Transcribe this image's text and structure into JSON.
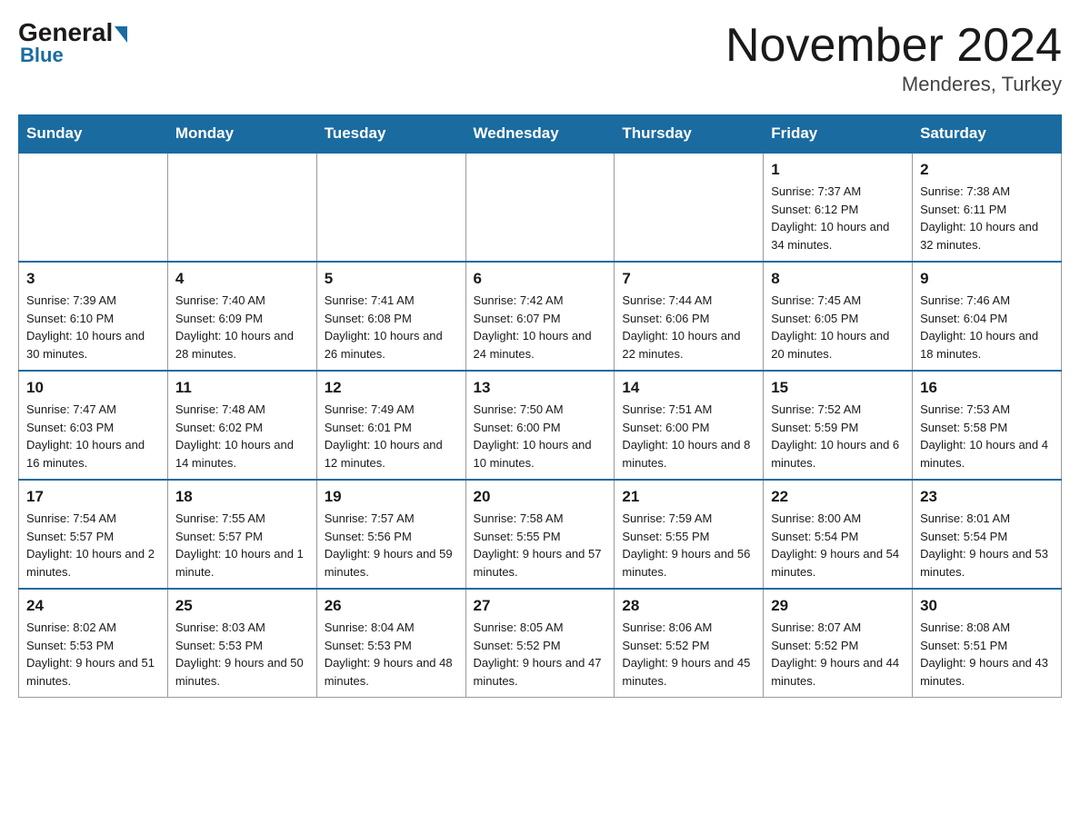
{
  "header": {
    "logo_general": "General",
    "logo_blue": "Blue",
    "month_year": "November 2024",
    "location": "Menderes, Turkey"
  },
  "days_of_week": [
    "Sunday",
    "Monday",
    "Tuesday",
    "Wednesday",
    "Thursday",
    "Friday",
    "Saturday"
  ],
  "weeks": [
    [
      {
        "day": "",
        "info": ""
      },
      {
        "day": "",
        "info": ""
      },
      {
        "day": "",
        "info": ""
      },
      {
        "day": "",
        "info": ""
      },
      {
        "day": "",
        "info": ""
      },
      {
        "day": "1",
        "info": "Sunrise: 7:37 AM\nSunset: 6:12 PM\nDaylight: 10 hours and 34 minutes."
      },
      {
        "day": "2",
        "info": "Sunrise: 7:38 AM\nSunset: 6:11 PM\nDaylight: 10 hours and 32 minutes."
      }
    ],
    [
      {
        "day": "3",
        "info": "Sunrise: 7:39 AM\nSunset: 6:10 PM\nDaylight: 10 hours and 30 minutes."
      },
      {
        "day": "4",
        "info": "Sunrise: 7:40 AM\nSunset: 6:09 PM\nDaylight: 10 hours and 28 minutes."
      },
      {
        "day": "5",
        "info": "Sunrise: 7:41 AM\nSunset: 6:08 PM\nDaylight: 10 hours and 26 minutes."
      },
      {
        "day": "6",
        "info": "Sunrise: 7:42 AM\nSunset: 6:07 PM\nDaylight: 10 hours and 24 minutes."
      },
      {
        "day": "7",
        "info": "Sunrise: 7:44 AM\nSunset: 6:06 PM\nDaylight: 10 hours and 22 minutes."
      },
      {
        "day": "8",
        "info": "Sunrise: 7:45 AM\nSunset: 6:05 PM\nDaylight: 10 hours and 20 minutes."
      },
      {
        "day": "9",
        "info": "Sunrise: 7:46 AM\nSunset: 6:04 PM\nDaylight: 10 hours and 18 minutes."
      }
    ],
    [
      {
        "day": "10",
        "info": "Sunrise: 7:47 AM\nSunset: 6:03 PM\nDaylight: 10 hours and 16 minutes."
      },
      {
        "day": "11",
        "info": "Sunrise: 7:48 AM\nSunset: 6:02 PM\nDaylight: 10 hours and 14 minutes."
      },
      {
        "day": "12",
        "info": "Sunrise: 7:49 AM\nSunset: 6:01 PM\nDaylight: 10 hours and 12 minutes."
      },
      {
        "day": "13",
        "info": "Sunrise: 7:50 AM\nSunset: 6:00 PM\nDaylight: 10 hours and 10 minutes."
      },
      {
        "day": "14",
        "info": "Sunrise: 7:51 AM\nSunset: 6:00 PM\nDaylight: 10 hours and 8 minutes."
      },
      {
        "day": "15",
        "info": "Sunrise: 7:52 AM\nSunset: 5:59 PM\nDaylight: 10 hours and 6 minutes."
      },
      {
        "day": "16",
        "info": "Sunrise: 7:53 AM\nSunset: 5:58 PM\nDaylight: 10 hours and 4 minutes."
      }
    ],
    [
      {
        "day": "17",
        "info": "Sunrise: 7:54 AM\nSunset: 5:57 PM\nDaylight: 10 hours and 2 minutes."
      },
      {
        "day": "18",
        "info": "Sunrise: 7:55 AM\nSunset: 5:57 PM\nDaylight: 10 hours and 1 minute."
      },
      {
        "day": "19",
        "info": "Sunrise: 7:57 AM\nSunset: 5:56 PM\nDaylight: 9 hours and 59 minutes."
      },
      {
        "day": "20",
        "info": "Sunrise: 7:58 AM\nSunset: 5:55 PM\nDaylight: 9 hours and 57 minutes."
      },
      {
        "day": "21",
        "info": "Sunrise: 7:59 AM\nSunset: 5:55 PM\nDaylight: 9 hours and 56 minutes."
      },
      {
        "day": "22",
        "info": "Sunrise: 8:00 AM\nSunset: 5:54 PM\nDaylight: 9 hours and 54 minutes."
      },
      {
        "day": "23",
        "info": "Sunrise: 8:01 AM\nSunset: 5:54 PM\nDaylight: 9 hours and 53 minutes."
      }
    ],
    [
      {
        "day": "24",
        "info": "Sunrise: 8:02 AM\nSunset: 5:53 PM\nDaylight: 9 hours and 51 minutes."
      },
      {
        "day": "25",
        "info": "Sunrise: 8:03 AM\nSunset: 5:53 PM\nDaylight: 9 hours and 50 minutes."
      },
      {
        "day": "26",
        "info": "Sunrise: 8:04 AM\nSunset: 5:53 PM\nDaylight: 9 hours and 48 minutes."
      },
      {
        "day": "27",
        "info": "Sunrise: 8:05 AM\nSunset: 5:52 PM\nDaylight: 9 hours and 47 minutes."
      },
      {
        "day": "28",
        "info": "Sunrise: 8:06 AM\nSunset: 5:52 PM\nDaylight: 9 hours and 45 minutes."
      },
      {
        "day": "29",
        "info": "Sunrise: 8:07 AM\nSunset: 5:52 PM\nDaylight: 9 hours and 44 minutes."
      },
      {
        "day": "30",
        "info": "Sunrise: 8:08 AM\nSunset: 5:51 PM\nDaylight: 9 hours and 43 minutes."
      }
    ]
  ]
}
